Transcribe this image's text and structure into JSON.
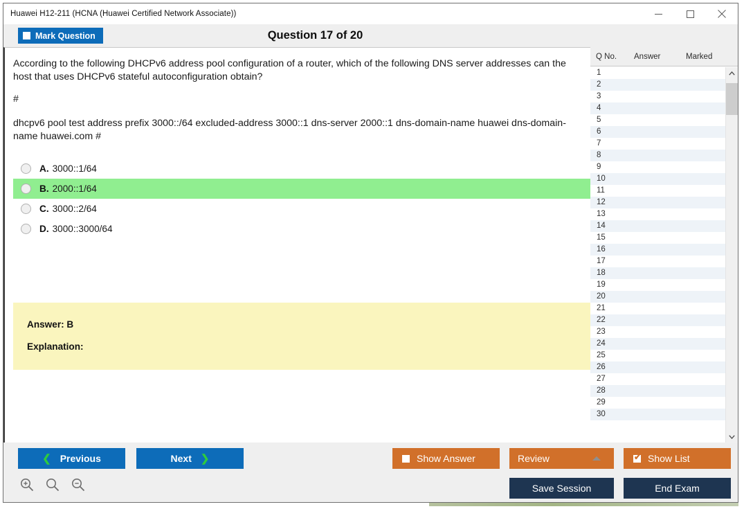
{
  "window": {
    "title": "Huawei H12-211 (HCNA (Huawei Certified Network Associate))",
    "minimize_icon": "minimize-icon",
    "maximize_icon": "maximize-icon",
    "close_icon": "close-icon"
  },
  "header": {
    "mark_question_label": "Mark Question",
    "mark_question_checked": false,
    "question_counter": "Question 17 of 20"
  },
  "question": {
    "prompt": "According to the following DHCPv6 address pool configuration of a router, which of the following DNS server addresses can the host that uses DHCPv6 stateful autoconfiguration obtain?",
    "separator": "#",
    "config": "dhcpv6 pool test address prefix 3000::/64 excluded-address 3000::1 dns-server 2000::1 dns-domain-name huawei dns-domain-name huawei.com #",
    "options": [
      {
        "letter": "A.",
        "text": "3000::1/64",
        "highlighted": false,
        "selected": false
      },
      {
        "letter": "B.",
        "text": "2000::1/64",
        "highlighted": true,
        "selected": false
      },
      {
        "letter": "C.",
        "text": "3000::2/64",
        "highlighted": false,
        "selected": false
      },
      {
        "letter": "D.",
        "text": "3000::3000/64",
        "highlighted": false,
        "selected": false
      }
    ],
    "answer_label": "Answer: B",
    "explanation_label": "Explanation:",
    "highlight_color": "#90EE90",
    "answer_box_color": "#FAF5BE"
  },
  "list_panel": {
    "columns": [
      "Q No.",
      "Answer",
      "Marked"
    ],
    "rows": [
      {
        "no": "1",
        "answer": "",
        "marked": ""
      },
      {
        "no": "2",
        "answer": "",
        "marked": ""
      },
      {
        "no": "3",
        "answer": "",
        "marked": ""
      },
      {
        "no": "4",
        "answer": "",
        "marked": ""
      },
      {
        "no": "5",
        "answer": "",
        "marked": ""
      },
      {
        "no": "6",
        "answer": "",
        "marked": ""
      },
      {
        "no": "7",
        "answer": "",
        "marked": ""
      },
      {
        "no": "8",
        "answer": "",
        "marked": ""
      },
      {
        "no": "9",
        "answer": "",
        "marked": ""
      },
      {
        "no": "10",
        "answer": "",
        "marked": ""
      },
      {
        "no": "11",
        "answer": "",
        "marked": ""
      },
      {
        "no": "12",
        "answer": "",
        "marked": ""
      },
      {
        "no": "13",
        "answer": "",
        "marked": ""
      },
      {
        "no": "14",
        "answer": "",
        "marked": ""
      },
      {
        "no": "15",
        "answer": "",
        "marked": ""
      },
      {
        "no": "16",
        "answer": "",
        "marked": ""
      },
      {
        "no": "17",
        "answer": "",
        "marked": ""
      },
      {
        "no": "18",
        "answer": "",
        "marked": ""
      },
      {
        "no": "19",
        "answer": "",
        "marked": ""
      },
      {
        "no": "20",
        "answer": "",
        "marked": ""
      },
      {
        "no": "21",
        "answer": "",
        "marked": ""
      },
      {
        "no": "22",
        "answer": "",
        "marked": ""
      },
      {
        "no": "23",
        "answer": "",
        "marked": ""
      },
      {
        "no": "24",
        "answer": "",
        "marked": ""
      },
      {
        "no": "25",
        "answer": "",
        "marked": ""
      },
      {
        "no": "26",
        "answer": "",
        "marked": ""
      },
      {
        "no": "27",
        "answer": "",
        "marked": ""
      },
      {
        "no": "28",
        "answer": "",
        "marked": ""
      },
      {
        "no": "29",
        "answer": "",
        "marked": ""
      },
      {
        "no": "30",
        "answer": "",
        "marked": ""
      }
    ],
    "scroll_up_icon": "chevron-up-icon",
    "scroll_down_icon": "chevron-down-icon"
  },
  "toolbar": {
    "previous_label": "Previous",
    "next_label": "Next",
    "show_answer_label": "Show Answer",
    "show_answer_checked": false,
    "review_label": "Review",
    "show_list_label": "Show List",
    "show_list_checked": true,
    "check_glyph": "✔",
    "save_session_label": "Save Session",
    "end_exam_label": "End Exam",
    "zoom_in_icon": "zoom-in-icon",
    "zoom_reset_icon": "zoom-reset-icon",
    "zoom_out_icon": "zoom-out-icon"
  },
  "colors": {
    "primary_blue": "#0d6cb9",
    "orange": "#d1702a",
    "navy": "#1e3551",
    "green_chevron": "#2ecb3e"
  }
}
